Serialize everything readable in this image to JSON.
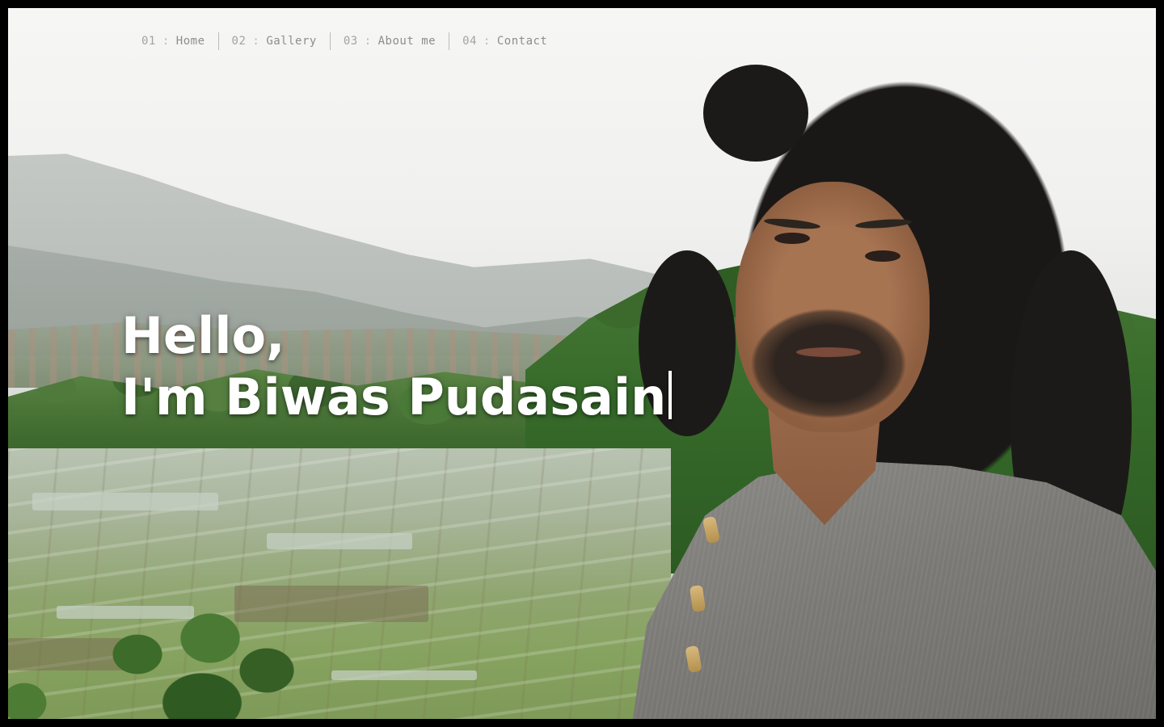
{
  "nav": {
    "items": [
      {
        "num": "01",
        "sep": ":",
        "label": "Home"
      },
      {
        "num": "02",
        "sep": ":",
        "label": "Gallery"
      },
      {
        "num": "03",
        "sep": ":",
        "label": "About me"
      },
      {
        "num": "04",
        "sep": ":",
        "label": "Contact"
      }
    ]
  },
  "hero": {
    "greeting": "Hello,",
    "intro": "I'm Biwas Pudasain"
  },
  "colors": {
    "background": "#000000",
    "hero_text": "#ffffff",
    "nav_text": "#8a8a8a"
  }
}
